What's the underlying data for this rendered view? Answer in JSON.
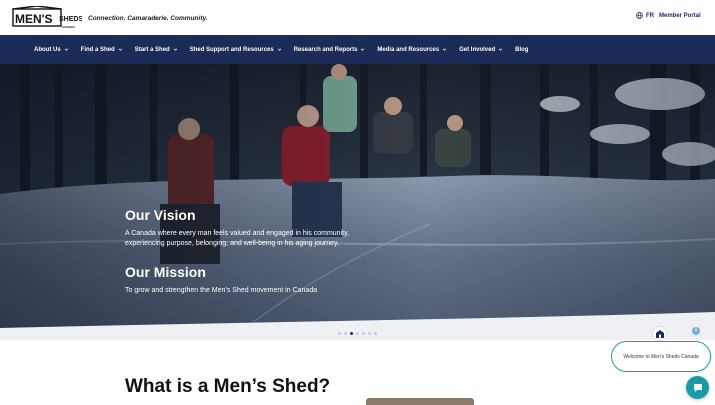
{
  "header": {
    "logo_alt": "MEN'S SHEDS CANADA",
    "tagline": "Connection. Camaraderie. Community.",
    "language": "FR",
    "member_portal": "Member Portal"
  },
  "nav": {
    "items": [
      {
        "label": "About Us",
        "dropdown": true
      },
      {
        "label": "Find a Shed",
        "dropdown": true
      },
      {
        "label": "Start a Shed",
        "dropdown": true
      },
      {
        "label": "Shed Support and Resources",
        "dropdown": true
      },
      {
        "label": "Research and Reports",
        "dropdown": true
      },
      {
        "label": "Media and Resources",
        "dropdown": true
      },
      {
        "label": "Get Involved",
        "dropdown": true
      },
      {
        "label": "Blog",
        "dropdown": false
      }
    ]
  },
  "hero": {
    "vision_heading": "Our Vision",
    "vision_text": "A Canada where every man feels valued and engaged in his community, experiencing purpose, belonging, and well-being in his aging journey.",
    "mission_heading": "Our Mission",
    "mission_text": "To grow and strengthen the Men’s Shed movement in Canada",
    "slides": 7,
    "active_slide": 3
  },
  "section": {
    "title": "What is a Men’s Shed?"
  },
  "chat": {
    "welcome": "Welcome to Men's Sheds Canada",
    "close": "×"
  },
  "colors": {
    "navy": "#1b2b5a",
    "teal": "#1b9aa6",
    "white": "#ffffff"
  },
  "icons": {
    "language": "globe-icon",
    "nav_dropdown": "chevron-down-icon",
    "chat": "chat-icon"
  }
}
